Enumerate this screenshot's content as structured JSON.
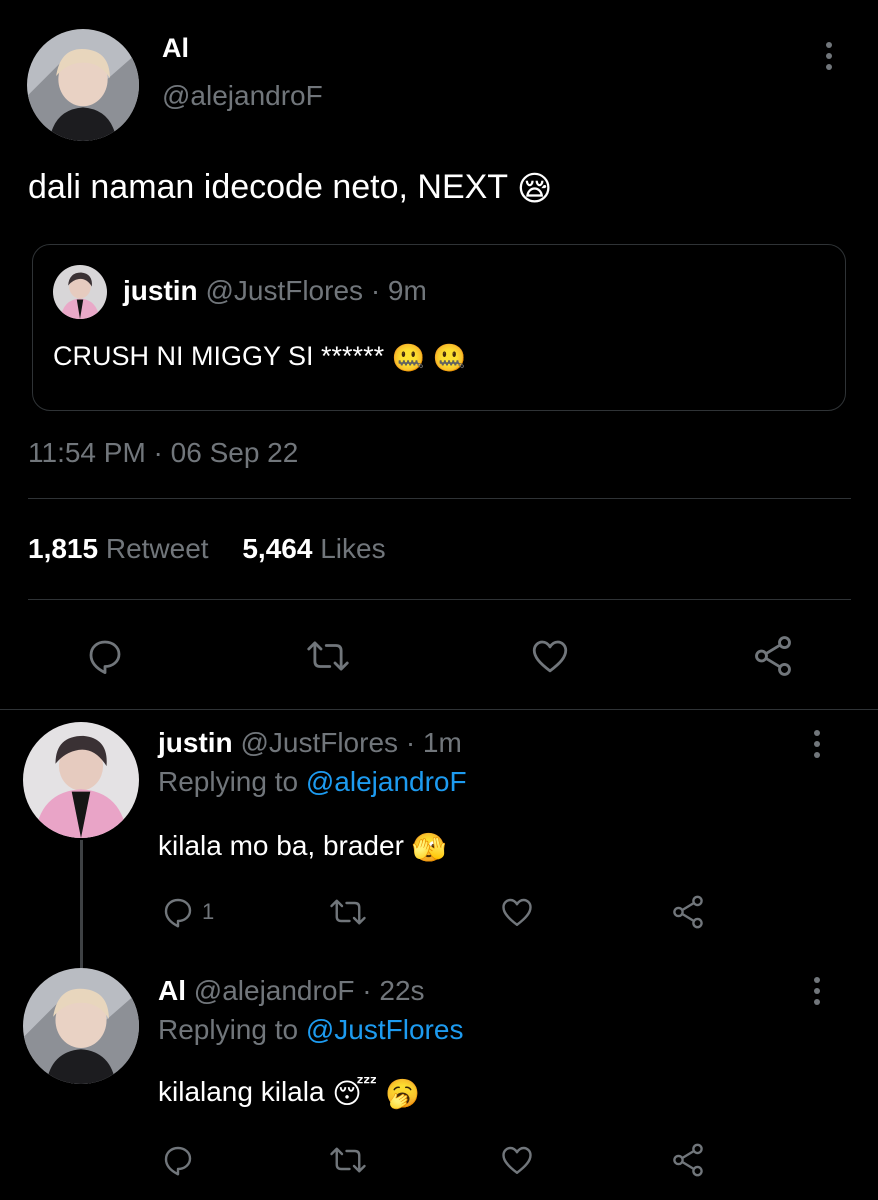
{
  "tweet": {
    "author_name": "Al",
    "author_handle": "@alejandroF",
    "text": "dali naman idecode neto, NEXT",
    "text_emoji": "😪",
    "quoted": {
      "author_name": "justin",
      "author_handle": "@JustFlores",
      "time": "9m",
      "text": "CRUSH NI MIGGY SI ******",
      "text_emoji": "🤐 🤐"
    },
    "timestamp": "11:54 PM · 06 Sep 22",
    "retweet_count": "1,815",
    "retweet_label": "Retweet",
    "likes_count": "5,464",
    "likes_label": "Likes"
  },
  "replies": [
    {
      "author_name": "justin",
      "author_handle": "@JustFlores",
      "time": "1m",
      "replying_prefix": "Replying to",
      "replying_to": "@alejandroF",
      "text": "kilala mo ba, brader",
      "text_emoji": "🫣",
      "reply_count": "1"
    },
    {
      "author_name": "Al",
      "author_handle": "@alejandroF",
      "time": "22s",
      "replying_prefix": "Replying to",
      "replying_to": "@JustFlores",
      "text": "kilalang kilala",
      "text_emoji": "😴 🥱",
      "reply_count": ""
    }
  ],
  "icons": {
    "reply": "reply-icon",
    "retweet": "retweet-icon",
    "like": "heart-icon",
    "share": "share-icon",
    "more": "more-vertical-icon"
  },
  "colors": {
    "background": "#000000",
    "text": "#ffffff",
    "secondary": "#71767b",
    "link": "#1d9bf0",
    "border": "#2f3336"
  }
}
